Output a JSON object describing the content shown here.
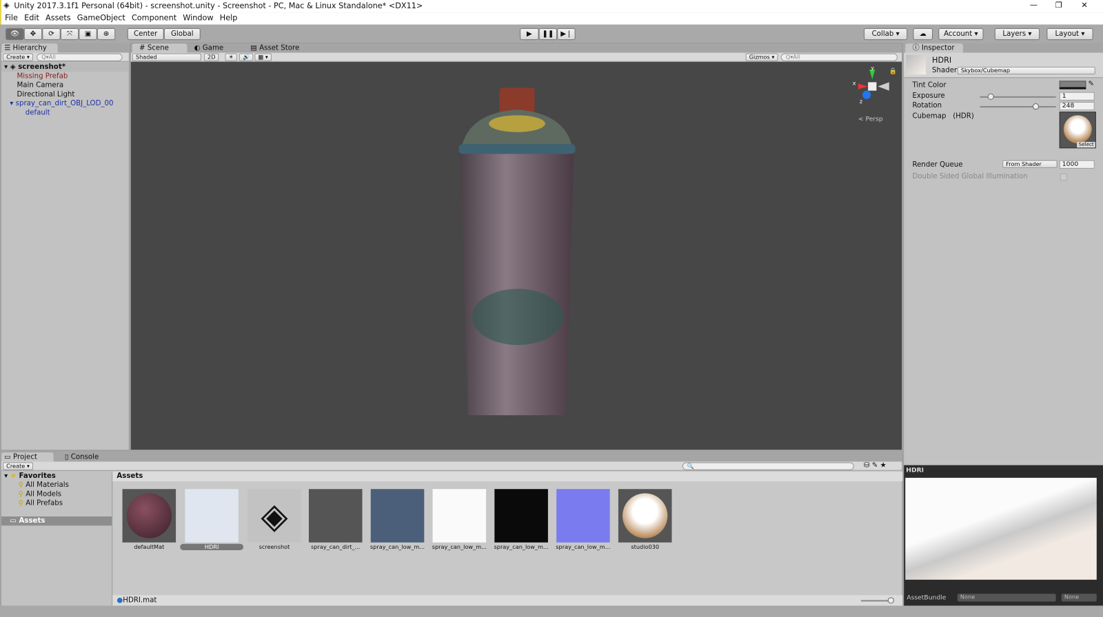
{
  "window": {
    "title": "Unity 2017.3.1f1 Personal (64bit) - screenshot.unity - Screenshot - PC, Mac & Linux Standalone* <DX11>",
    "controls": [
      "—",
      "❐",
      "✕"
    ]
  },
  "menu": [
    "File",
    "Edit",
    "Assets",
    "GameObject",
    "Component",
    "Window",
    "Help"
  ],
  "toolbar": {
    "center": "Center",
    "global": "Global",
    "collab": "Collab ▾",
    "account": "Account",
    "layers": "Layers",
    "layout": "Layout"
  },
  "hierarchy": {
    "tab": "Hierarchy",
    "create": "Create ▾",
    "search": "Q▾All",
    "scene": "screenshot*",
    "items": [
      {
        "label": "Missing Prefab"
      },
      {
        "label": "Main Camera"
      },
      {
        "label": "Directional Light"
      },
      {
        "label": "spray_can_dirt_OBJ_LOD_00"
      },
      {
        "label": "default"
      }
    ]
  },
  "scene": {
    "tabs": [
      "Scene",
      "Game",
      "Asset Store"
    ],
    "shading": "Shaded",
    "mode2d": "2D",
    "gizmos": "Gizmos ▾",
    "search": "Q▾All",
    "persp": "Persp",
    "axes": {
      "x": "x",
      "y": "y",
      "z": "z"
    }
  },
  "inspector": {
    "tab": "Inspector",
    "name": "HDRI",
    "shader_label": "Shader",
    "shader": "Skybox/Cubemap",
    "props": {
      "tint": "Tint Color",
      "exposure": "Exposure",
      "exposure_val": "1",
      "rotation": "Rotation",
      "rotation_val": "248",
      "cubemap": "Cubemap",
      "hdr": "(HDR)",
      "select": "Select"
    },
    "exposure_fraction": 0.1,
    "rotation_fraction": 0.69,
    "render_queue": "Render Queue",
    "rq_mode": "From Shader",
    "rq_val": "1000",
    "dsgi": "Double Sided Global Illumination"
  },
  "preview": {
    "title": "HDRI",
    "assetbundle": "AssetBundle",
    "ab_value": "None",
    "ab_variant": "None"
  },
  "project": {
    "tabs": [
      "Project",
      "Console"
    ],
    "create": "Create ▾",
    "favorites": "Favorites",
    "fav_items": [
      "All Materials",
      "All Models",
      "All Prefabs"
    ],
    "assets_folder": "Assets",
    "breadcrumb": "Assets",
    "status": "HDRI.mat",
    "assets": [
      {
        "label": "defaultMat",
        "color": "#5a2f3a"
      },
      {
        "label": "HDRI",
        "color": "#dfe6f0"
      },
      {
        "label": "screenshot",
        "color": "#c2c2c2"
      },
      {
        "label": "spray_can_dirt_...",
        "color": "#555"
      },
      {
        "label": "spray_can_low_m...",
        "color": "#4b5f7a"
      },
      {
        "label": "spray_can_low_m...",
        "color": "#fafafa"
      },
      {
        "label": "spray_can_low_m...",
        "color": "#0a0a0a"
      },
      {
        "label": "spray_can_low_m...",
        "color": "#7b7bf0"
      },
      {
        "label": "studio030",
        "color": "#555"
      }
    ]
  }
}
